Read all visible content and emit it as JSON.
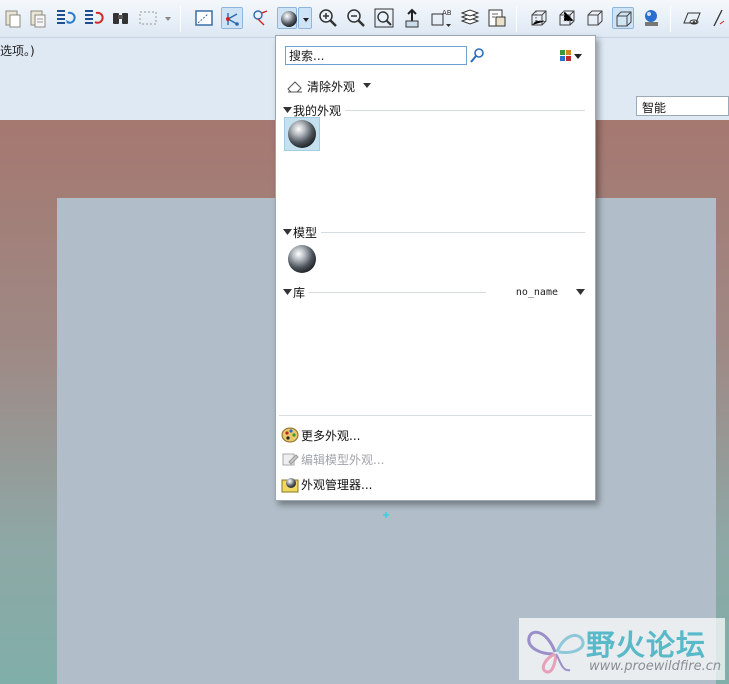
{
  "toolbar": {
    "icons": [
      "paste-icon",
      "paste-special-icon",
      "regenerate-icon",
      "regenerate-manager-icon",
      "find-icon",
      "selection-box-icon",
      "select-dropdown-icon",
      "graphics-window-icon",
      "datum-display-icon",
      "datum-filter-icon",
      "appearance-gallery-icon",
      "appearance-dropdown-icon",
      "zoom-in-icon",
      "zoom-out-icon",
      "refit-icon",
      "orient-icon",
      "annotation-display-icon",
      "layers-icon",
      "view-manager-icon",
      "wireframe-icon",
      "hidden-line-icon",
      "no-hidden-icon",
      "shading-icon",
      "display-style-icon",
      "perspective-icon",
      "sketch-view-icon"
    ]
  },
  "ribbon": {
    "hint_text": "选项。)",
    "filter_value": "智能"
  },
  "appearance_panel": {
    "search_placeholder": "搜索...",
    "clear_label": "清除外观",
    "my_appearances_label": "我的外观",
    "model_label": "模型",
    "library_label": "库",
    "library_name": "no_name",
    "actions": {
      "more": "更多外观...",
      "edit_model": "编辑模型外观...",
      "manager": "外观管理器..."
    }
  },
  "watermark": {
    "title": "野火论坛",
    "url": "www.proewildfire.cn"
  }
}
